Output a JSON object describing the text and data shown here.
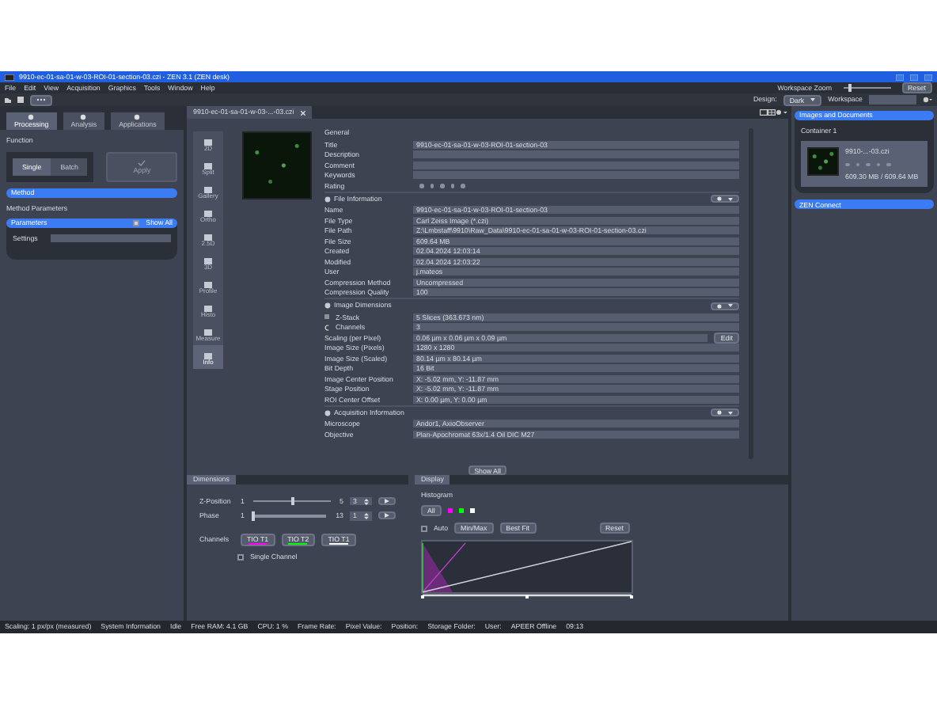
{
  "window": {
    "title": "9910-ec-01-sa-01-w-03-ROI-01-section-03.czi - ZEN 3.1 (ZEN desk)"
  },
  "menu": [
    "File",
    "Edit",
    "View",
    "Acquisition",
    "Graphics",
    "Tools",
    "Window",
    "Help"
  ],
  "toolbar": {
    "zoom_label": "Workspace Zoom",
    "zoom_slider": {
      "level": 0.1
    },
    "reset": "Reset",
    "design_label": "Design:",
    "design_value": "Dark",
    "workspace_label": "Workspace"
  },
  "left_panel": {
    "tabs": [
      {
        "label": "Processing",
        "selected": true
      },
      {
        "label": "Analysis",
        "selected": false
      },
      {
        "label": "Applications",
        "selected": false
      }
    ],
    "function_label": "Function",
    "modes": [
      {
        "label": "Single",
        "selected": true
      },
      {
        "label": "Batch",
        "selected": false
      }
    ],
    "apply": {
      "label": "Apply",
      "disabled": true
    },
    "method": "Method",
    "method_parameters": "Method Parameters",
    "parameters": "Parameters",
    "show_all": {
      "label": "Show All",
      "checked": true
    },
    "settings_label": "Settings"
  },
  "document_tab": "9910-ec-01-sa-01-w-03-...-03.czi",
  "view_tabs": [
    {
      "label": "2D",
      "selected": false
    },
    {
      "label": "Split",
      "selected": false
    },
    {
      "label": "Gallery",
      "selected": false
    },
    {
      "label": "Ortho",
      "selected": false
    },
    {
      "label": "2.5D",
      "selected": false
    },
    {
      "label": "3D",
      "selected": false
    },
    {
      "label": "Profile",
      "selected": false
    },
    {
      "label": "Histo",
      "selected": false
    },
    {
      "label": "Measure",
      "selected": false
    },
    {
      "label": "Info",
      "selected": true
    }
  ],
  "info_sections": [
    {
      "title": "General",
      "menu": false,
      "rows": [
        {
          "label": "Title",
          "value": "9910-ec-01-sa-01-w-03-ROI-01-section-03"
        },
        {
          "label": "Description",
          "value": ""
        },
        {
          "label": "Comment",
          "value": ""
        },
        {
          "label": "Keywords",
          "value": ""
        },
        {
          "label": "Rating",
          "kind": "rating",
          "stars": 0
        }
      ]
    },
    {
      "title": "File Information",
      "menu": true,
      "rows": [
        {
          "label": "Name",
          "value": "9910-ec-01-sa-01-w-03-ROI-01-section-03"
        },
        {
          "label": "File Type",
          "value": "Carl Zeiss Image (*.czi)"
        },
        {
          "label": "File Path",
          "value": "Z:\\Lmbstaff\\9910\\Raw_Data\\9910-ec-01-sa-01-w-03-ROI-01-section-03.czi"
        },
        {
          "label": "File Size",
          "value": "609.64 MB"
        },
        {
          "label": "Created",
          "value": "02.04.2024 12:03:14"
        },
        {
          "label": "Modified",
          "value": "02.04.2024 12:03:22"
        },
        {
          "label": "User",
          "value": "j.mateos"
        },
        {
          "label": "Compression Method",
          "value": "Uncompressed"
        },
        {
          "label": "Compression Quality",
          "value": "100"
        }
      ]
    },
    {
      "title": "Image Dimensions",
      "menu": true,
      "rows": [
        {
          "label": "Z-Stack",
          "kind": "zstack",
          "value": "5 Slices (363.673 nm)"
        },
        {
          "label": "Channels",
          "kind": "channels",
          "value": "3"
        },
        {
          "label": "Scaling (per Pixel)",
          "value": "0.06 µm x 0.06 µm x 0.09 µm",
          "button": "Edit"
        },
        {
          "label": "Image Size (Pixels)",
          "value": "1280 x 1280"
        },
        {
          "label": "Image Size (Scaled)",
          "value": "80.14 µm x 80.14 µm"
        },
        {
          "label": "Bit Depth",
          "value": "16 Bit"
        },
        {
          "label": "Image Center Position",
          "value": "X: -5.02 mm, Y: -11.87 mm"
        },
        {
          "label": "Stage Position",
          "value": "X: -5.02 mm, Y: -11.87 mm"
        },
        {
          "label": "ROI Center Offset",
          "value": "X: 0.00 µm, Y: 0.00 µm"
        }
      ]
    },
    {
      "title": "Acquisition Information",
      "menu": true,
      "rows": [
        {
          "label": "Microscope",
          "value": "Andor1, AxioObserver"
        },
        {
          "label": "Objective",
          "value": "Plan-Apochromat 63x/1.4 Oil DIC M27"
        }
      ]
    }
  ],
  "show_all_button": "Show All",
  "dimensions": {
    "title": "Dimensions",
    "sliders": [
      {
        "label": "Z-Position",
        "min": "1",
        "max": "5",
        "value": "3",
        "level": 0.5
      },
      {
        "label": "Phase",
        "min": "1",
        "max": "13",
        "value": "1",
        "level": 0
      }
    ],
    "channels_label": "Channels",
    "channels": [
      {
        "label": "TIO T1",
        "color": "#ff00ff"
      },
      {
        "label": "TIO T2",
        "color": "#00ff00"
      },
      {
        "label": "TIO T1",
        "color": "#ffffff"
      }
    ],
    "single_channel": {
      "label": "Single Channel",
      "checked": false
    }
  },
  "display": {
    "title": "Display",
    "histogram_label": "Histogram",
    "all": "All",
    "colors": [
      {
        "color": "#ff00ff"
      },
      {
        "color": "#00ff00"
      },
      {
        "color": "#ffffff"
      }
    ],
    "auto": {
      "label": "Auto",
      "checked": false
    },
    "buttons": [
      "Min/Max",
      "Best Fit"
    ],
    "reset": "Reset"
  },
  "right_panel": {
    "title": "Images and Documents",
    "container": "Container 1",
    "file_name": "9910-...-03.czi",
    "file_size": "609.30 MB / 609.64 MB",
    "stars": 0,
    "zen_connect": "ZEN Connect"
  },
  "status_bar": [
    "Scaling: 1 px/px (measured)",
    "System Information",
    "Idle",
    "Free RAM: 4.1 GB",
    "CPU: 1 %",
    "Frame Rate:",
    "Pixel Value:",
    "Position:",
    "Storage Folder:",
    "User:",
    "APEER Offline",
    "09:13"
  ]
}
